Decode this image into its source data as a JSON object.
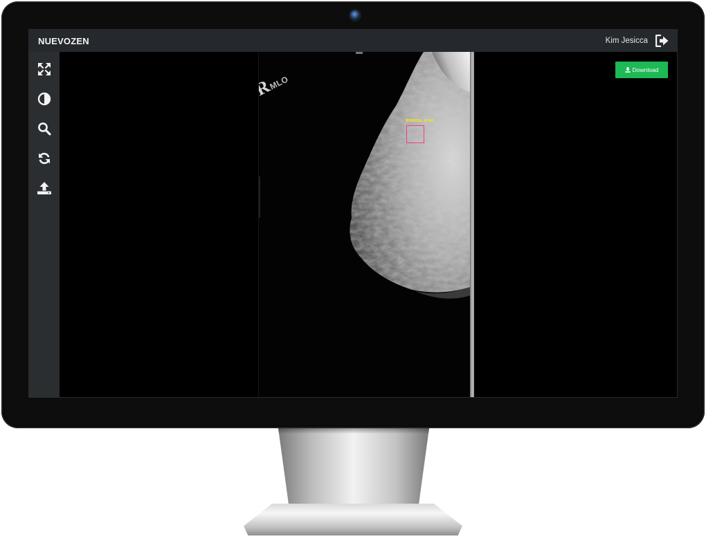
{
  "header": {
    "brand": "NUEVOZEN",
    "user_name": "Kim Jesicca",
    "logout_icon": "sign-out-icon"
  },
  "toolbar": {
    "items": [
      {
        "icon": "fullscreen-arrows-icon"
      },
      {
        "icon": "contrast-icon"
      },
      {
        "icon": "magnifier-icon"
      },
      {
        "icon": "refresh-icon"
      },
      {
        "icon": "upload-icon"
      }
    ]
  },
  "viewer": {
    "download_label": "Download",
    "download_icon": "download-icon",
    "image_marker": {
      "letter": "R",
      "view": "MLO"
    },
    "finding": {
      "label": "BENIGN",
      "score": "0.90"
    }
  },
  "colors": {
    "header_bg": "#25282c",
    "toolbar_bg": "#2b2e31",
    "download_green": "#1db954",
    "finding_box": "#ef3c8a",
    "finding_text": "#f2ea17"
  }
}
